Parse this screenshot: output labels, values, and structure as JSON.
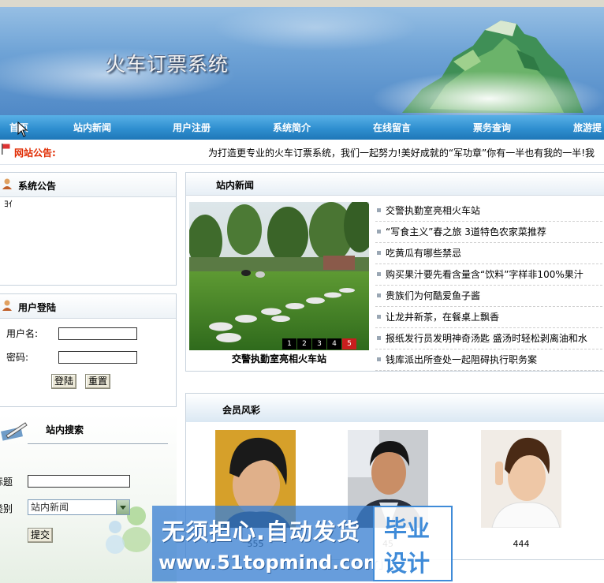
{
  "header": {
    "title": "火车订票系统"
  },
  "nav": {
    "items": [
      "首页",
      "站内新闻",
      "用户注册",
      "系统简介",
      "在线留言",
      "票务查询",
      "旅游提"
    ]
  },
  "notice": {
    "label": "网站公告:",
    "text": "为打造更专业的火车订票系统，我们一起努力!美好成就的“军功章”你有一半也有我的一半!我"
  },
  "announcement": {
    "title": "系统公告",
    "body": "ﾖｲ"
  },
  "login": {
    "title": "用户登陆",
    "username_label": "用户名:",
    "password_label": "密码:",
    "login_button": "登陆",
    "reset_button": "重置"
  },
  "search": {
    "title": "站内搜索",
    "title_label": "标题",
    "category_label": "类别",
    "category_value": "站内新闻",
    "submit_button": "提交"
  },
  "news": {
    "title": "站内新闻",
    "photo_caption": "交警执勤室亮相火车站",
    "pager": [
      "1",
      "2",
      "3",
      "4",
      "5"
    ],
    "active_page": "5",
    "items": [
      "交警执勤室亮相火车站",
      "“写食主义”春之旅 3道特色农家菜推荐",
      "吃黄瓜有哪些禁忌",
      "购买果汁要先看含量含“饮料”字样非100%果汁",
      "贵族们为何酷爱鱼子酱",
      "让龙井新茶，在餐桌上飘香",
      "报纸发行员发明神奇汤匙 盛汤时轻松剥离油和水",
      "钱库派出所查处一起阻碍执行职务案"
    ]
  },
  "members": {
    "title": "会员风彩",
    "list": [
      {
        "name": "555"
      },
      {
        "name": "45"
      },
      {
        "name": "444"
      }
    ]
  },
  "watermark": {
    "line1": "无须担心.自动发货",
    "line2": "www.51topmind.com",
    "box_line1": "毕业",
    "box_line2": "设计"
  },
  "colors": {
    "nav_blue": "#2f8fd0",
    "notice_red": "#e02a00",
    "pager_active": "#c81e1e"
  }
}
